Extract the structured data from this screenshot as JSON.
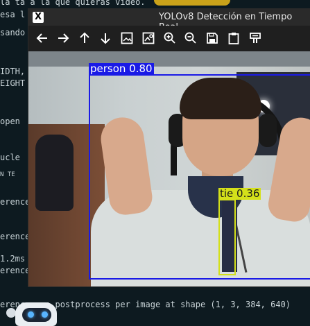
{
  "window": {
    "title": "YOLOv8 Detección en Tiempo Real",
    "app_icon_glyph": "X"
  },
  "toolbar": {
    "buttons": [
      {
        "name": "back-button",
        "icon": "arrow-left-icon"
      },
      {
        "name": "forward-button",
        "icon": "arrow-right-icon"
      },
      {
        "name": "up-button",
        "icon": "arrow-up-icon"
      },
      {
        "name": "down-button",
        "icon": "arrow-down-icon"
      },
      {
        "name": "image-button",
        "icon": "image-icon"
      },
      {
        "name": "image-properties-button",
        "icon": "image-settings-icon"
      },
      {
        "name": "zoom-in-button",
        "icon": "zoom-in-icon"
      },
      {
        "name": "zoom-out-button",
        "icon": "zoom-out-icon"
      },
      {
        "name": "save-button",
        "icon": "save-icon"
      },
      {
        "name": "copy-button",
        "icon": "clipboard-icon"
      },
      {
        "name": "properties-button",
        "icon": "properties-icon"
      }
    ]
  },
  "detections": [
    {
      "label": "person 0.80",
      "color": "#1a1ae6"
    },
    {
      "label": "tie 0.36",
      "color": "#d4e01a"
    }
  ],
  "terminal": {
    "lines": [
      "la ta a la que quieras  video.",
      "esa l",
      "sando",
      "IDTH,",
      "EIGHT",
      "open",
      "ucle",
      "erence",
      "erence",
      "1.2ms",
      "erence",
      "erence:        ms postprocess per image at shape (1, 3, 384, 640)"
    ],
    "tabs": "N    TE"
  }
}
